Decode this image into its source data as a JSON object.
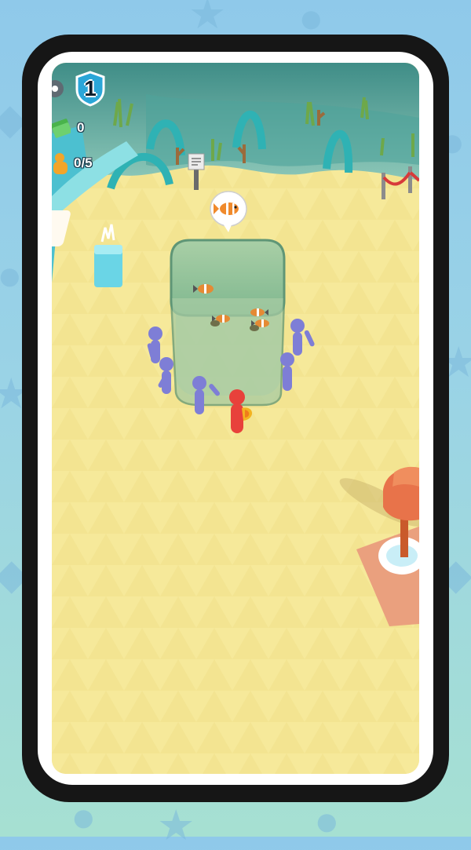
{
  "hud": {
    "level": "1",
    "cash": "0",
    "capacity": "0/5",
    "icons": {
      "settings": "gear-icon",
      "level": "shield-badge-icon",
      "cash": "cash-stack-icon",
      "visitors": "visitor-group-icon"
    }
  },
  "speech_bubble": {
    "icon": "clownfish-icon"
  },
  "colors": {
    "sand": "#f6e99a",
    "water": "#8cc9a0",
    "visitor": "#7e7ed6",
    "player": "#e8413b",
    "frame": "#161616",
    "background": "#9ad3e6"
  }
}
